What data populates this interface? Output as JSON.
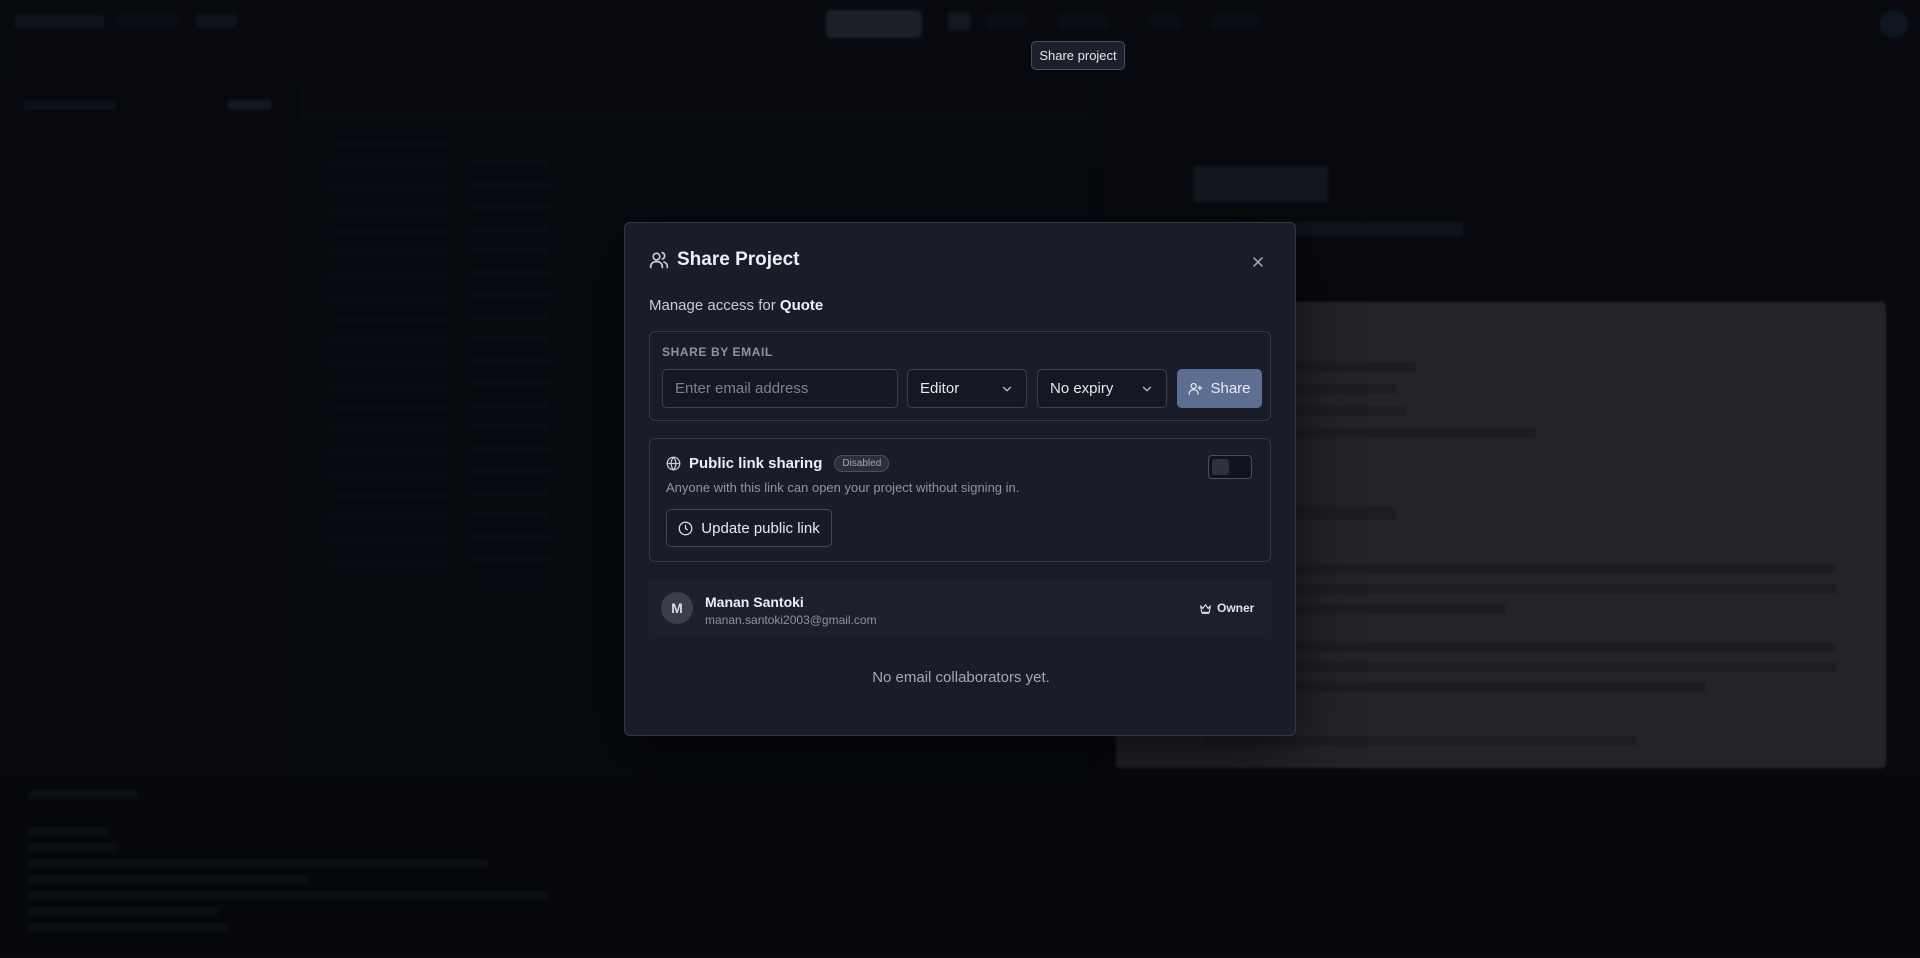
{
  "tooltip": {
    "text": "Share project"
  },
  "dialog": {
    "title": "Share Project",
    "subtitle_prefix": "Manage access for",
    "project_name": "Quote",
    "share_by_email": {
      "label": "SHARE BY EMAIL",
      "email_placeholder": "Enter email address",
      "email_value": "",
      "role_selected": "Editor",
      "expiry_selected": "No expiry",
      "share_label": "Share"
    },
    "public_link": {
      "title": "Public link sharing",
      "status_badge": "Disabled",
      "description": "Anyone with this link can open your project without signing in.",
      "enabled": false,
      "update_label": "Update public link"
    },
    "members": [
      {
        "initial": "M",
        "name": "Manan Santoki",
        "email": "manan.santoki2003@gmail.com",
        "role": "Owner"
      }
    ],
    "empty_message": "No email collaborators yet."
  },
  "colors": {
    "backdrop": "#0b0d14",
    "dialog_bg": "#1a1c29",
    "share_button": "#5e6d92",
    "border": "#343848"
  },
  "icons": {
    "title": "users-icon",
    "close": "close-icon",
    "dropdown": "chevron-down-icon",
    "share": "user-plus-icon",
    "public": "globe-icon",
    "update": "clock-icon",
    "owner": "crown-icon"
  }
}
